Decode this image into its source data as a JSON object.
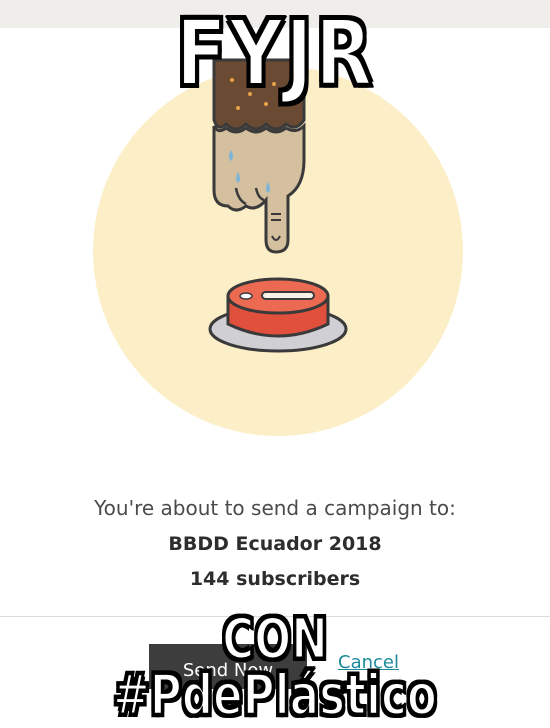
{
  "meme": {
    "top_text": "FYJR",
    "bottom_text": "CON #PdePlástico"
  },
  "dialog": {
    "prompt": "You're about to send a campaign to:",
    "list_name": "BBDD Ecuador 2018",
    "subscribers": "144 subscribers"
  },
  "actions": {
    "send_label": "Send Now",
    "cancel_label": "Cancel"
  },
  "colors": {
    "circle": "#fcefc7",
    "button_red": "#e0503c",
    "cancel_link": "#1a8a9a",
    "send_button": "#3d3d3d"
  },
  "icons": [
    "hand-pointing-icon",
    "red-button-icon",
    "sweat-drop-icon"
  ]
}
